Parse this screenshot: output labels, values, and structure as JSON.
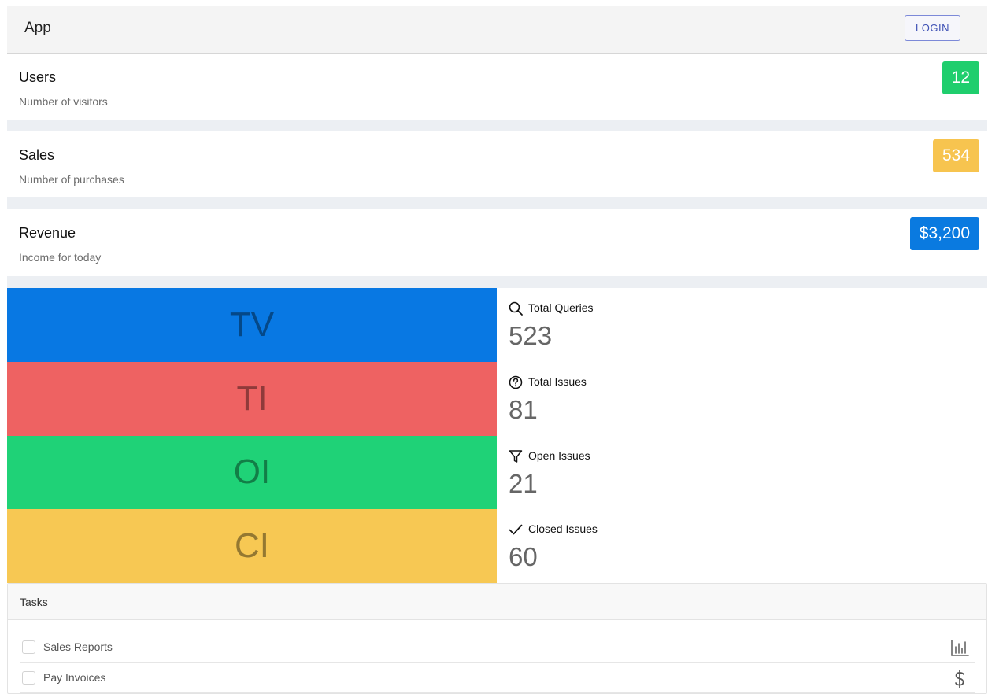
{
  "header": {
    "app_title": "App",
    "login_label": "LOGIN"
  },
  "stats": [
    {
      "title": "Users",
      "description": "Number of visitors",
      "value": "12",
      "color": "#1fce6d"
    },
    {
      "title": "Sales",
      "description": "Number of purchases",
      "value": "534",
      "color": "#f7c44f"
    },
    {
      "title": "Revenue",
      "description": "Income for today",
      "value": "$3,200",
      "color": "#0a7ae0"
    }
  ],
  "tiles": [
    {
      "abbr": "TV",
      "color": "#0878e3",
      "label": "Total Queries",
      "value": "523",
      "icon": "search-icon"
    },
    {
      "abbr": "TI",
      "color": "#ee6262",
      "label": "Total Issues",
      "value": "81",
      "icon": "question-circle-icon"
    },
    {
      "abbr": "OI",
      "color": "#1fd277",
      "label": "Open Issues",
      "value": "21",
      "icon": "filter-icon"
    },
    {
      "abbr": "CI",
      "color": "#f7c853",
      "label": "Closed Issues",
      "value": "60",
      "icon": "check-icon"
    }
  ],
  "tasks": {
    "title": "Tasks",
    "items": [
      {
        "label": "Sales Reports",
        "icon": "bar-chart-icon"
      },
      {
        "label": "Pay Invoices",
        "icon": "dollar-icon"
      }
    ]
  }
}
